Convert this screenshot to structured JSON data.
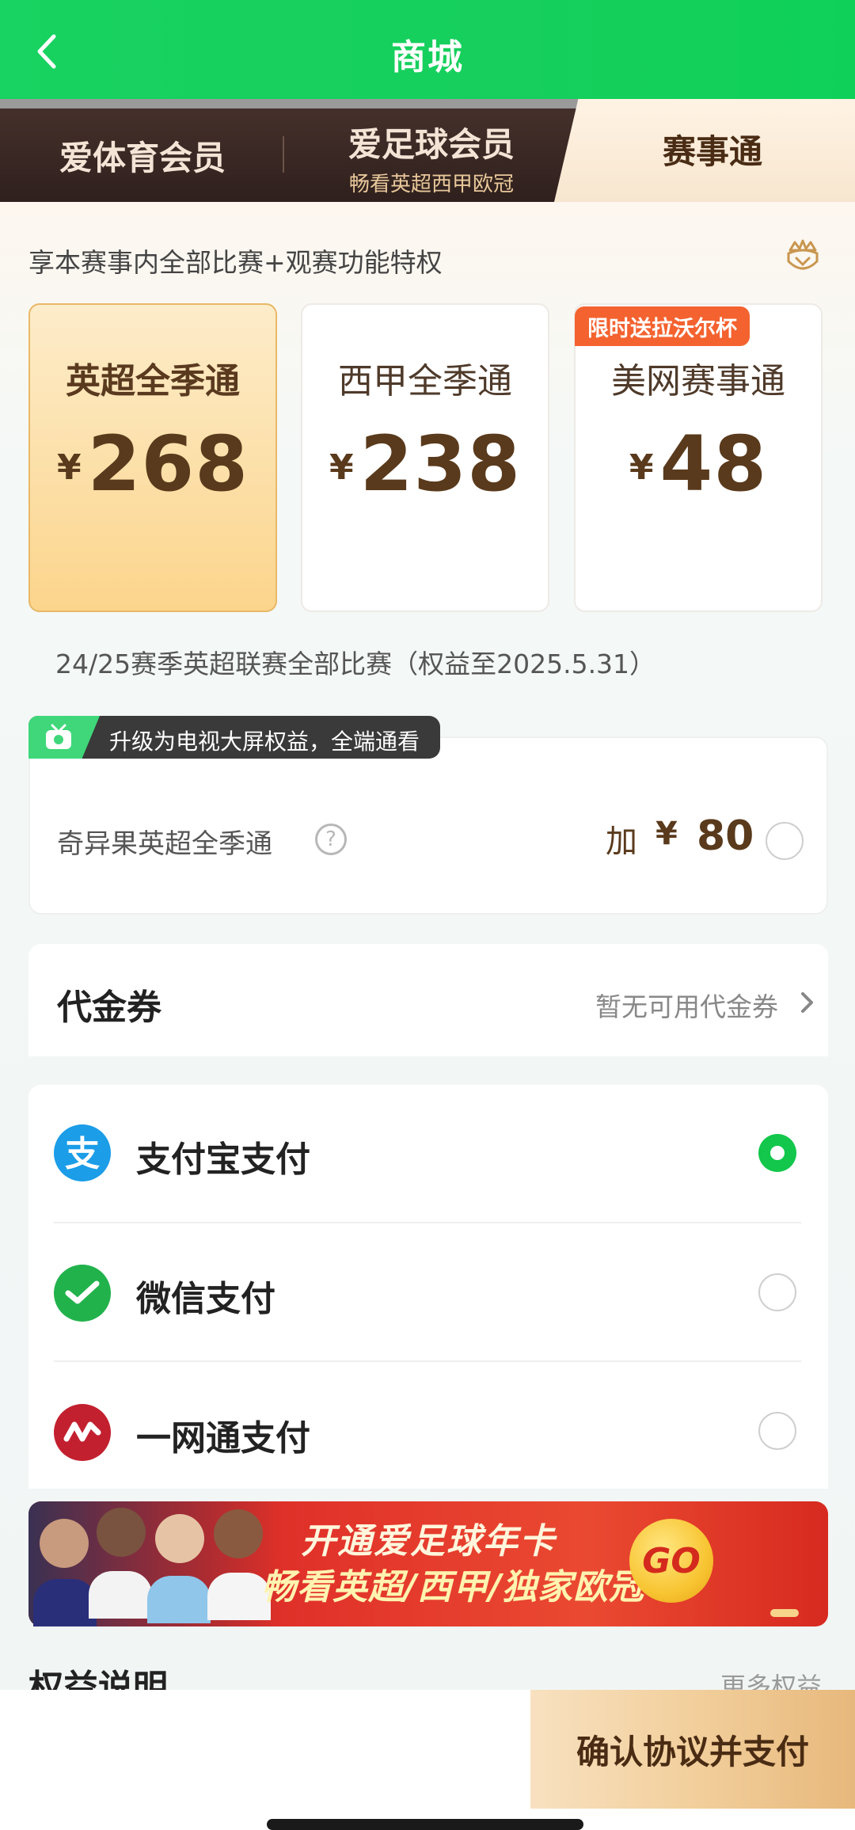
{
  "header": {
    "title": "商城"
  },
  "tabs": [
    {
      "label": "爱体育会员",
      "sublabel": ""
    },
    {
      "label": "爱足球会员",
      "sublabel": "畅看英超西甲欧冠"
    },
    {
      "label": "赛事通",
      "sublabel": ""
    }
  ],
  "privilege": {
    "text": "享本赛事内全部比赛+观赛功能特权"
  },
  "passes": [
    {
      "title": "英超全季通",
      "currency": "¥",
      "price": "268",
      "selected": true
    },
    {
      "title": "西甲全季通",
      "currency": "¥",
      "price": "238",
      "selected": false
    },
    {
      "title": "美网赛事通",
      "currency": "¥",
      "price": "48",
      "selected": false,
      "badge": "限时送拉沃尔杯"
    }
  ],
  "season_desc": "24/25赛季英超联赛全部比赛（权益至2025.5.31）",
  "upgrade": {
    "tag": "升级为电视大屏权益，全端通看",
    "label": "奇异果英超全季通",
    "add": "加",
    "currency": "¥",
    "price": "80",
    "selected": false
  },
  "voucher": {
    "title": "代金券",
    "status": "暂无可用代金券"
  },
  "payment": [
    {
      "label": "支付宝支付",
      "icon": "alipay-icon",
      "color": "#1b9de8",
      "selected": true
    },
    {
      "label": "微信支付",
      "icon": "wechat-pay-icon",
      "color": "#22b24c",
      "selected": false
    },
    {
      "label": "一网通支付",
      "icon": "cmb-pay-icon",
      "color": "#c3202f",
      "selected": false
    }
  ],
  "banner": {
    "line1": "开通爱足球年卡",
    "line2": "畅看英超/西甲/独家欧冠",
    "go": "GO"
  },
  "rights": {
    "title": "权益说明",
    "more": "更多权益"
  },
  "bottom": {
    "pay_button": "确认协议并支付"
  },
  "colors": {
    "header_green": "#16cf5c",
    "tab_dark": "#3b2a26",
    "gold_text": "#5a3a1c",
    "promo_orange": "#f4622f",
    "selected_green": "#12c74b"
  }
}
